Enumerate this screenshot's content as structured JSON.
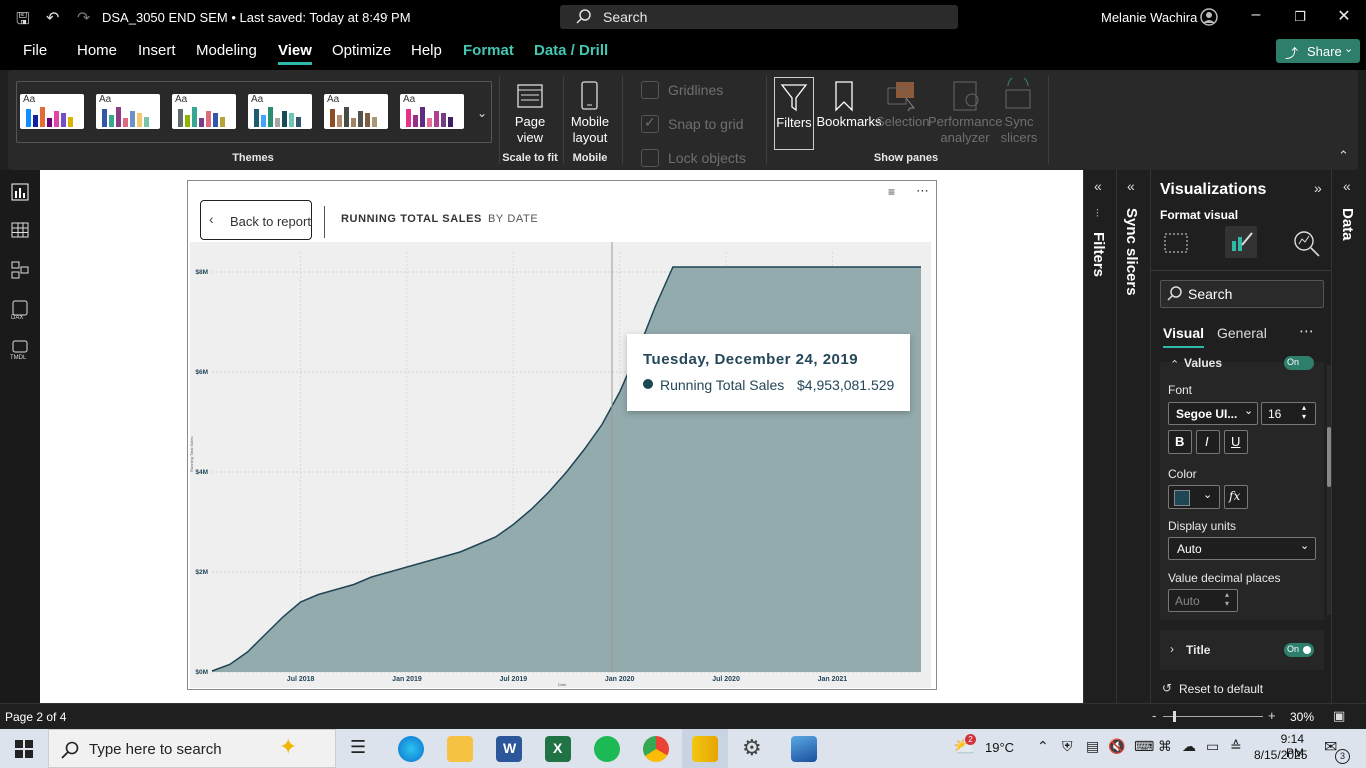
{
  "titlebar": {
    "doc_title": "DSA_3050 END SEM • Last saved: Today at 8:49 PM",
    "search_placeholder": "Search",
    "user_name": "Melanie Wachira"
  },
  "menu": {
    "file": "File",
    "home": "Home",
    "insert": "Insert",
    "modeling": "Modeling",
    "view": "View",
    "optimize": "Optimize",
    "help": "Help",
    "format": "Format",
    "data_drill": "Data / Drill",
    "share": "Share"
  },
  "ribbon": {
    "themes_label": "Themes",
    "page_view": "Page view",
    "scale_to_fit": "Scale to fit",
    "mobile_layout": "Mobile layout",
    "mobile": "Mobile",
    "gridlines": "Gridlines",
    "snap_to_grid": "Snap to grid",
    "lock_objects": "Lock objects",
    "filters": "Filters",
    "bookmarks": "Bookmarks",
    "selection": "Selection",
    "performance_analyzer": "Performance analyzer",
    "sync_slicers": "Sync slicers",
    "show_panes": "Show panes",
    "themes": [
      {
        "aa": "Aa",
        "colors": [
          "#118DFF",
          "#12239E",
          "#E66C37",
          "#6B007B",
          "#E044A7",
          "#744EC2",
          "#D9B300"
        ]
      },
      {
        "aa": "Aa",
        "colors": [
          "#3257A8",
          "#37A794",
          "#8B3D88",
          "#DD6B7F",
          "#6B91C9",
          "#F5C869",
          "#77C4A8"
        ]
      },
      {
        "aa": "Aa",
        "colors": [
          "#5F6B6D",
          "#8CB400",
          "#37A794",
          "#7A3D8C",
          "#DD6B7F",
          "#3257A8",
          "#B5A337"
        ]
      },
      {
        "aa": "Aa",
        "colors": [
          "#1E5D6F",
          "#41A4FF",
          "#2A8F6F",
          "#A6A6A6",
          "#184A57",
          "#6FC4B4",
          "#30566E"
        ]
      },
      {
        "aa": "Aa",
        "colors": [
          "#8F4C26",
          "#B38B6D",
          "#494C44",
          "#A08366",
          "#54504A",
          "#7D5C3F",
          "#AA9874"
        ]
      },
      {
        "aa": "Aa",
        "colors": [
          "#E8318A",
          "#9B2D86",
          "#5E2C80",
          "#E86E9A",
          "#B0418C",
          "#763D87",
          "#401F63"
        ]
      }
    ]
  },
  "report": {
    "back_button": "Back to report",
    "title": "RUNNING TOTAL SALES",
    "subtitle": "BY DATE",
    "tooltip": {
      "date": "Tuesday, December 24, 2019",
      "series": "Running Total Sales",
      "value": "$4,953,081.529"
    }
  },
  "chart_data": {
    "type": "area",
    "ylabel": "Running Total Sales",
    "xlabel": "Date",
    "y_ticks": [
      "$0M",
      "$2M",
      "$4M",
      "$6M",
      "$8M"
    ],
    "x_ticks": [
      "Jul 2018",
      "Jan 2019",
      "Jul 2019",
      "Jan 2020",
      "Jul 2020",
      "Jan 2021"
    ],
    "ylim": [
      0,
      8400000
    ],
    "grid": true,
    "color": "#93abad",
    "line_color": "#1f4655",
    "series": [
      {
        "name": "Running Total Sales",
        "x": [
          "2018-02",
          "2018-03",
          "2018-04",
          "2018-05",
          "2018-06",
          "2018-07",
          "2018-08",
          "2018-09",
          "2018-10",
          "2018-11",
          "2018-12",
          "2019-01",
          "2019-02",
          "2019-03",
          "2019-04",
          "2019-05",
          "2019-06",
          "2019-07",
          "2019-08",
          "2019-09",
          "2019-10",
          "2019-11",
          "2019-12",
          "2020-01",
          "2020-02",
          "2020-03",
          "2020-04",
          "2020-05",
          "2020-06",
          "2020-07",
          "2020-08",
          "2020-09",
          "2020-10",
          "2020-11",
          "2020-12",
          "2021-01",
          "2021-02",
          "2021-03",
          "2021-04",
          "2021-05",
          "2021-06"
        ],
        "values": [
          0.02,
          0.15,
          0.4,
          0.75,
          1.1,
          1.4,
          1.55,
          1.65,
          1.75,
          1.9,
          2.0,
          2.1,
          2.2,
          2.3,
          2.4,
          2.55,
          2.7,
          2.95,
          3.25,
          3.6,
          4.0,
          4.45,
          4.95,
          5.6,
          6.4,
          7.3,
          8.1,
          8.1,
          8.1,
          8.1,
          8.1,
          8.1,
          8.1,
          8.1,
          8.1,
          8.1,
          8.1,
          8.1,
          8.1,
          8.1,
          8.1
        ],
        "units": "$M"
      }
    ]
  },
  "viz_pane": {
    "title": "Visualizations",
    "format_visual": "Format visual",
    "search": "Search",
    "tab_visual": "Visual",
    "tab_general": "General",
    "values_section": "Values",
    "font_label": "Font",
    "font_family": "Segoe UI...",
    "font_size": "16",
    "bold": "B",
    "italic": "I",
    "underline": "U",
    "color_label": "Color",
    "color_value": "#1f4655",
    "fx": "fx",
    "display_units_label": "Display units",
    "display_units": "Auto",
    "decimal_label": "Value decimal places",
    "decimal_placeholder": "Auto",
    "title_section": "Title",
    "toggle_on": "On",
    "reset": "Reset to default"
  },
  "side_panes": {
    "filters": "Filters",
    "sync_slicers": "Sync slicers",
    "data": "Data"
  },
  "status": {
    "page": "Page 2 of 4",
    "zoom": "30%"
  },
  "taskbar": {
    "search": "Type here to search",
    "weather": "19°C",
    "time": "9:14 PM",
    "date": "8/15/2025",
    "notif_count": "3",
    "weather_badge": "2"
  }
}
